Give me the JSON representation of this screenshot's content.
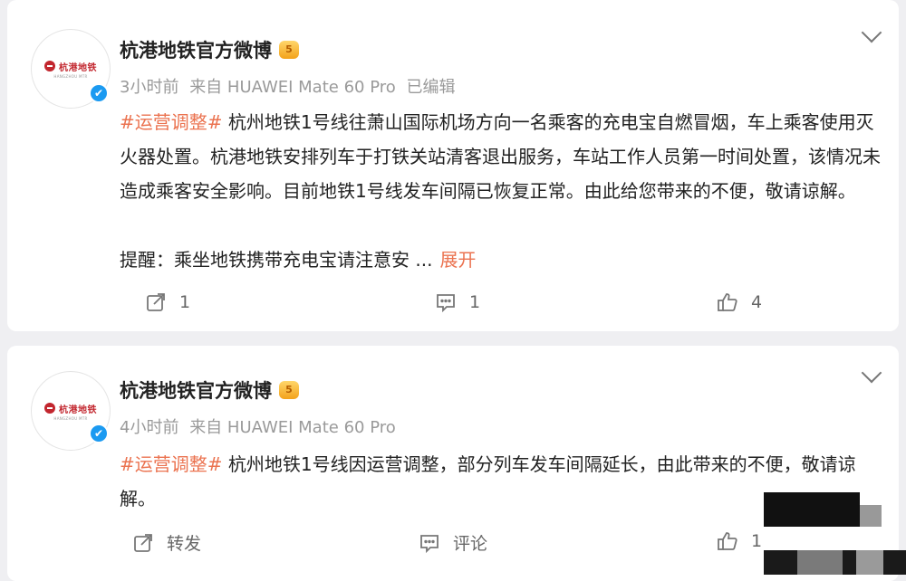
{
  "posts": [
    {
      "author": "杭港地铁官方微博",
      "vip_badge": "5",
      "logo_text": "杭港地铁",
      "logo_sub": "HANGZHOU MTR",
      "time": "3小时前",
      "source": "来自 HUAWEI Mate 60 Pro",
      "edited": "已编辑",
      "tag": "#运营调整#",
      "text": " 杭州地铁1号线往萧山国际机场方向一名乘客的充电宝自燃冒烟，车上乘客使用灭火器处置。杭港地铁安排列车于打铁关站清客退出服务，车站工作人员第一时间处置，该情况未造成乘客安全影响。目前地铁1号线发车间隔已恢复正常。由此给您带来的不便，敬请谅解。",
      "reminder": "提醒：乘坐地铁携带充电宝请注意安 ...",
      "expand": "展开",
      "repost": "1",
      "comment": "1",
      "like": "4"
    },
    {
      "author": "杭港地铁官方微博",
      "vip_badge": "5",
      "logo_text": "杭港地铁",
      "logo_sub": "HANGZHOU MTR",
      "time": "4小时前",
      "source": "来自 HUAWEI Mate 60 Pro",
      "tag": "#运营调整#",
      "text": " 杭州地铁1号线因运营调整，部分列车发车间隔延长，由此带来的不便，敬请谅解。",
      "repost": "转发",
      "comment": "评论",
      "like": "1"
    }
  ],
  "icons": {
    "verified": "✔"
  },
  "colors": {
    "accent": "#eb7350",
    "verified": "#1b9af1",
    "logo": "#c2262e"
  }
}
